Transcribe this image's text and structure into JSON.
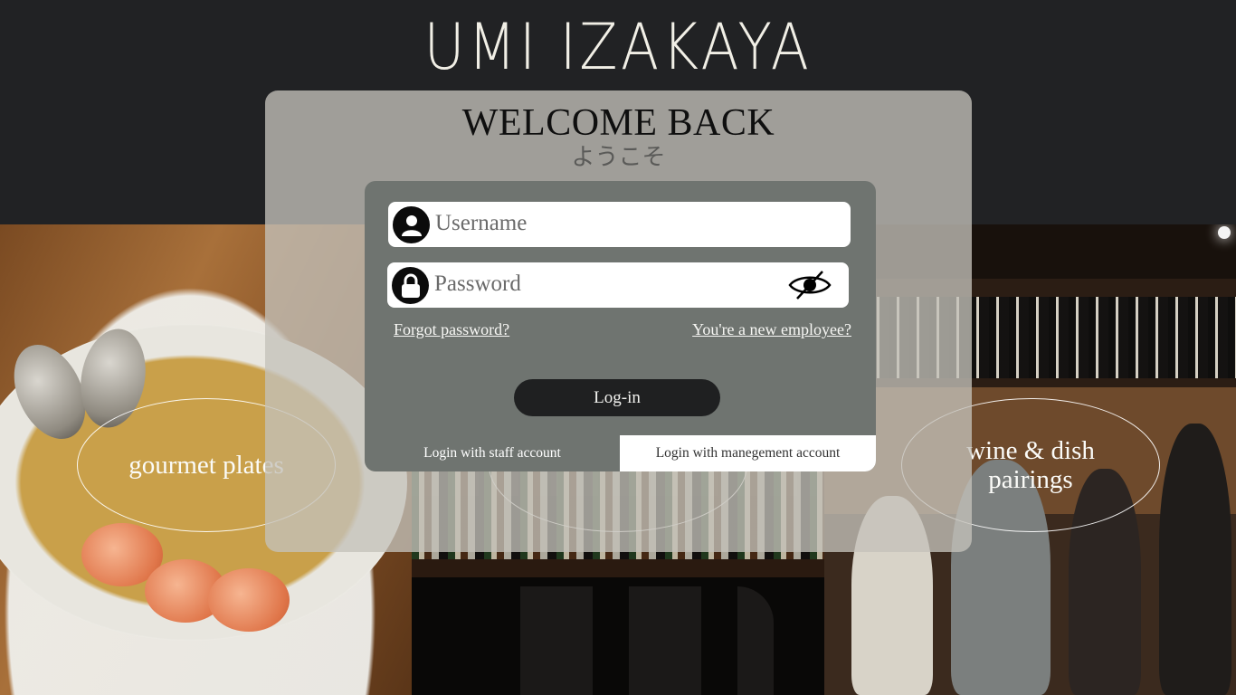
{
  "brand": {
    "name": "UMI IZAKAYA"
  },
  "welcome": {
    "title": "WELCOME BACK",
    "subtitle": "ようこそ"
  },
  "login_form": {
    "username_placeholder": "Username",
    "password_placeholder": "Password",
    "forgot_password": "Forgot password?",
    "new_employee": "You're a new employee?",
    "login_button": "Log-in",
    "tabs": [
      {
        "label": "Login with staff account",
        "active": true
      },
      {
        "label": "Login with manegement account",
        "active": false
      }
    ]
  },
  "gallery": {
    "captions": [
      {
        "label": "gourmet plates"
      },
      {
        "label": ""
      },
      {
        "label": "wine & dish pairings"
      }
    ]
  },
  "colors": {
    "background_dark": "#212224",
    "panel": "#c4c1ba",
    "card": "#6f7470",
    "button": "#1f2021",
    "brand_text": "#f1efe6"
  },
  "icons": {
    "username": "user-icon",
    "password": "lock-icon",
    "toggle": "eye-off-icon"
  }
}
